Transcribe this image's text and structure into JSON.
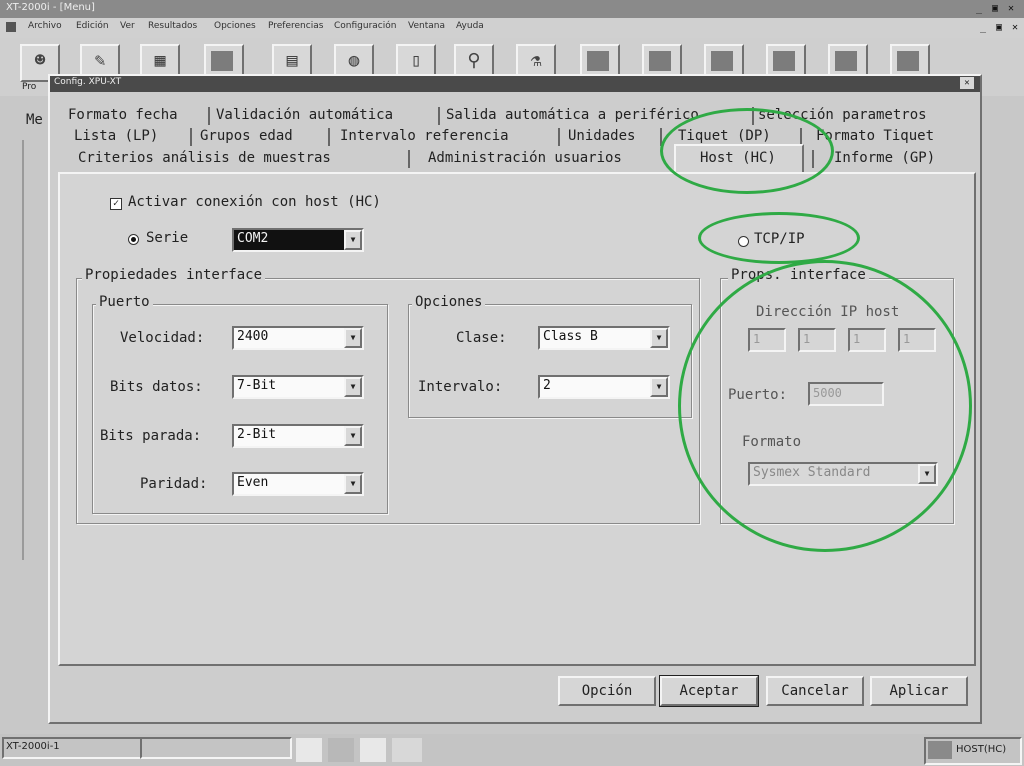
{
  "app": {
    "title": "XT-2000i - [Menu]",
    "window_controls": [
      "_",
      "▣",
      "✕"
    ]
  },
  "menu": [
    "Archivo",
    "Edición",
    "Ver",
    "Resultados",
    "Opciones",
    "Preferencias",
    "Configuración",
    "Ventana",
    "Ayuda"
  ],
  "toolbar": {
    "icons": [
      "user-icon",
      "pen-icon",
      "grid-icon",
      "gray-tile-icon",
      "chart-icon",
      "globe-icon",
      "document-icon",
      "magnifier-icon",
      "flask-icon",
      "gray-tile-icon",
      "gray-tile-icon",
      "gray-tile-icon",
      "gray-tile-icon",
      "gray-tile-icon",
      "gray-tile-icon"
    ],
    "first_label": "Pro"
  },
  "sidebar": {
    "label": "Me"
  },
  "dialog": {
    "title": "Config. XPU-XT",
    "close": "✕",
    "tabs_row1": [
      "Formato fecha",
      "Validación automática",
      "Salida automática a periférico",
      "selección parametros"
    ],
    "tabs_row2": [
      "Lista (LP)",
      "Grupos edad",
      "Intervalo referencia",
      "Unidades",
      "Tiquet (DP)",
      "Formato Tiquet"
    ],
    "tabs_row3": [
      "Criterios análisis de  muestras",
      "Administración usuarios",
      "Host (HC)",
      "Informe (GP)"
    ],
    "active_tab": "Host (HC)",
    "host": {
      "activate_label": "Activar conexión con host (HC)",
      "activate_checked": true,
      "serie_label": "Serie",
      "serie_value": "COM2",
      "tcpip_label": "TCP/IP",
      "interface_props": "Propiedades interface",
      "puerto_group": "Puerto",
      "velocidad_label": "Velocidad:",
      "velocidad_value": "2400",
      "bits_datos_label": "Bits datos:",
      "bits_datos_value": "7-Bit",
      "bits_parada_label": "Bits parada:",
      "bits_parada_value": "2-Bit",
      "paridad_label": "Paridad:",
      "paridad_value": "Even",
      "opciones_group": "Opciones",
      "clase_label": "Clase:",
      "clase_value": "Class B",
      "intervalo_label": "Intervalo:",
      "intervalo_value": "2",
      "props_interface_short": "Props. interface",
      "ip_title": "Dirección IP host",
      "ip_parts": [
        "1",
        "1",
        "1",
        "1"
      ],
      "puerto_label": "Puerto:",
      "puerto_value": "5000",
      "formato_label": "Formato",
      "formato_value": "Sysmex Standard"
    },
    "buttons": {
      "opcion": "Opción",
      "aceptar": "Aceptar",
      "cancelar": "Cancelar",
      "aplicar": "Aplicar"
    }
  },
  "statusbar": {
    "left": "XT-2000i-1",
    "right": "HOST(HC)"
  },
  "annotation_color": "#2faa45"
}
